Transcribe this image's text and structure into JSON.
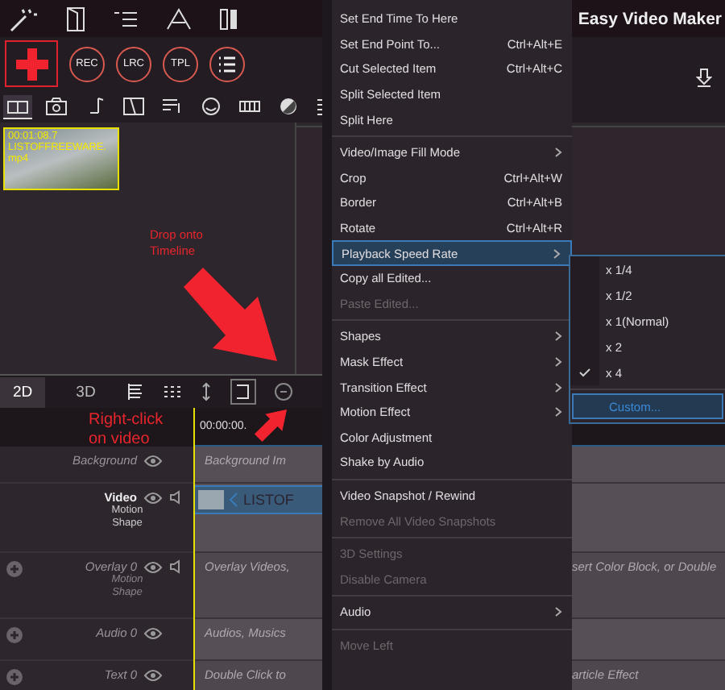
{
  "window": {
    "title": "Easy Video Maker"
  },
  "round_buttons": [
    {
      "label": "REC",
      "kind": "text"
    },
    {
      "label": "LRC",
      "kind": "text"
    },
    {
      "label": "TPL",
      "kind": "text"
    },
    {
      "kind": "list"
    }
  ],
  "media_tabs": [
    {
      "kind": "storyboard",
      "selected": true
    },
    {
      "kind": "camera",
      "selected": false
    },
    {
      "kind": "music",
      "selected": false
    },
    {
      "kind": "film",
      "selected": false
    },
    {
      "kind": "lyrics",
      "selected": false
    },
    {
      "kind": "smiley",
      "selected": false
    },
    {
      "kind": "battery",
      "selected": false
    },
    {
      "kind": "contrast",
      "selected": false
    },
    {
      "kind": "list",
      "selected": false
    }
  ],
  "media_clip": {
    "duration": "00:01:08.7",
    "name": "LISTOFFREEWARE.mp4"
  },
  "annotations": [
    {
      "text": "Drop onto Timeline"
    },
    {
      "text": "Right-click on video"
    }
  ],
  "view_tabs": [
    {
      "label": "2D",
      "selected": true
    },
    {
      "label": "3D",
      "selected": false
    }
  ],
  "timeline": {
    "time": "00:00:00.",
    "tracks": [
      {
        "name": "Background",
        "kind": "plain",
        "add": false,
        "speaker": false,
        "content": "Background Im"
      },
      {
        "name": "Video",
        "kind": "main",
        "sublabel": "Motion Shape",
        "add": false,
        "speaker": true,
        "content": "LISTOF"
      },
      {
        "name": "Overlay 0",
        "kind": "plain",
        "sublabel": "Motion Shape",
        "add": true,
        "speaker": true,
        "content": "Overlay Videos,",
        "content_right": "sert Color Block, or Double"
      },
      {
        "name": "Audio 0",
        "kind": "plain",
        "add": true,
        "speaker": false,
        "content": "Audios, Musics"
      },
      {
        "name": "Text 0",
        "kind": "plain",
        "add": true,
        "speaker": false,
        "content": "Double Click to",
        "content_right": "article Effect"
      }
    ]
  },
  "context_menu": [
    {
      "kind": "item",
      "label": "Set End Time To Here",
      "submenu": false,
      "disabled": false,
      "selected": false
    },
    {
      "kind": "item",
      "label": "Set End Point To...",
      "shortcut": "Ctrl+Alt+E",
      "submenu": false,
      "disabled": false,
      "selected": false
    },
    {
      "kind": "item",
      "label": "Cut Selected Item",
      "shortcut": "Ctrl+Alt+C",
      "submenu": false,
      "disabled": false,
      "selected": false
    },
    {
      "kind": "item",
      "label": "Split Selected Item",
      "submenu": false,
      "disabled": false,
      "selected": false
    },
    {
      "kind": "item",
      "label": "Split Here",
      "submenu": false,
      "disabled": false,
      "selected": false
    },
    {
      "kind": "separator"
    },
    {
      "kind": "item",
      "label": "Video/Image Fill Mode",
      "submenu": true,
      "disabled": false,
      "selected": false
    },
    {
      "kind": "item",
      "label": "Crop",
      "shortcut": "Ctrl+Alt+W",
      "submenu": false,
      "disabled": false,
      "selected": false
    },
    {
      "kind": "item",
      "label": "Border",
      "shortcut": "Ctrl+Alt+B",
      "submenu": false,
      "disabled": false,
      "selected": false
    },
    {
      "kind": "item",
      "label": "Rotate",
      "shortcut": "Ctrl+Alt+R",
      "submenu": false,
      "disabled": false,
      "selected": false
    },
    {
      "kind": "item",
      "label": "Playback Speed Rate",
      "submenu": true,
      "disabled": false,
      "selected": true
    },
    {
      "kind": "item",
      "label": "Copy all Edited...",
      "submenu": false,
      "disabled": false,
      "selected": false
    },
    {
      "kind": "item",
      "label": "Paste Edited...",
      "submenu": false,
      "disabled": true,
      "selected": false
    },
    {
      "kind": "separator"
    },
    {
      "kind": "item",
      "label": "Shapes",
      "submenu": true,
      "disabled": false,
      "selected": false
    },
    {
      "kind": "item",
      "label": "Mask Effect",
      "submenu": true,
      "disabled": false,
      "selected": false
    },
    {
      "kind": "item",
      "label": "Transition Effect",
      "submenu": true,
      "disabled": false,
      "selected": false
    },
    {
      "kind": "item",
      "label": "Motion Effect",
      "submenu": true,
      "disabled": false,
      "selected": false
    },
    {
      "kind": "item",
      "label": "Color Adjustment",
      "submenu": false,
      "disabled": false,
      "selected": false
    },
    {
      "kind": "item",
      "label": "Shake by Audio",
      "submenu": false,
      "disabled": false,
      "selected": false
    },
    {
      "kind": "separator"
    },
    {
      "kind": "item",
      "label": "Video Snapshot / Rewind",
      "submenu": false,
      "disabled": false,
      "selected": false
    },
    {
      "kind": "item",
      "label": "Remove All Video Snapshots",
      "submenu": false,
      "disabled": true,
      "selected": false
    },
    {
      "kind": "separator"
    },
    {
      "kind": "item",
      "label": "3D Settings",
      "submenu": false,
      "disabled": true,
      "selected": false
    },
    {
      "kind": "item",
      "label": "Disable Camera",
      "submenu": false,
      "disabled": true,
      "selected": false
    },
    {
      "kind": "separator"
    },
    {
      "kind": "item",
      "label": "Audio",
      "submenu": true,
      "disabled": false,
      "selected": false
    },
    {
      "kind": "separator"
    },
    {
      "kind": "item",
      "label": "Move Left",
      "submenu": false,
      "disabled": true,
      "selected": false
    }
  ],
  "speed_submenu": [
    {
      "kind": "item",
      "label": "x 1/4",
      "checked": false,
      "selected": false
    },
    {
      "kind": "item",
      "label": "x 1/2",
      "checked": false,
      "selected": false
    },
    {
      "kind": "item",
      "label": "x 1(Normal)",
      "checked": false,
      "selected": false
    },
    {
      "kind": "item",
      "label": "x 2",
      "checked": false,
      "selected": false
    },
    {
      "kind": "item",
      "label": "x 4",
      "checked": true,
      "selected": false
    },
    {
      "kind": "separator"
    },
    {
      "kind": "item",
      "label": "Custom...",
      "checked": false,
      "selected": true
    }
  ]
}
